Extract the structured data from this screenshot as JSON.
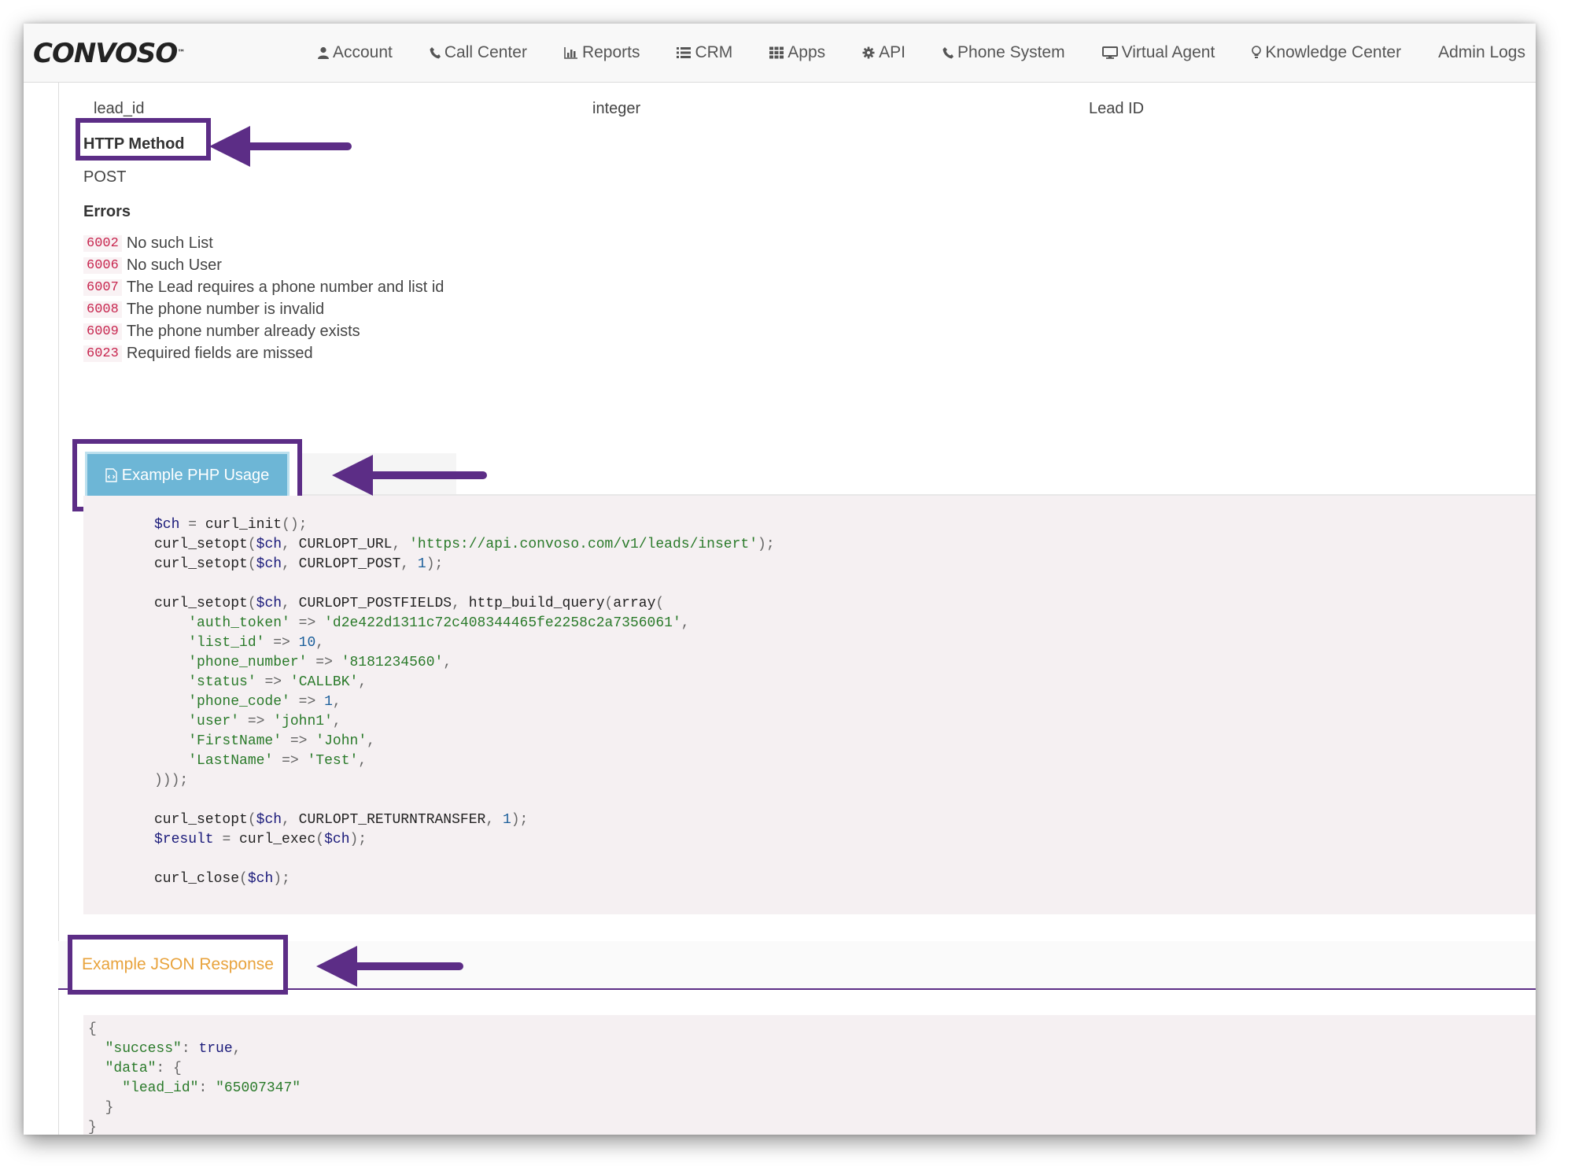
{
  "brand": {
    "logo_text": "CONVOSO"
  },
  "nav": {
    "items": [
      {
        "label": "Account",
        "icon": "user-icon"
      },
      {
        "label": "Call Center",
        "icon": "phone-icon"
      },
      {
        "label": "Reports",
        "icon": "bar-chart-icon"
      },
      {
        "label": "CRM",
        "icon": "list-icon"
      },
      {
        "label": "Apps",
        "icon": "grid-icon"
      },
      {
        "label": "API",
        "icon": "gear-icon"
      },
      {
        "label": "Phone System",
        "icon": "phone-icon"
      },
      {
        "label": "Virtual Agent",
        "icon": "monitor-icon"
      },
      {
        "label": "Knowledge Center",
        "icon": "lightbulb-icon"
      },
      {
        "label": "Admin Logs",
        "icon": ""
      }
    ]
  },
  "params_row": {
    "name": "lead_id",
    "type": "integer",
    "description": "Lead ID"
  },
  "http_method": {
    "title": "HTTP Method",
    "value": "POST"
  },
  "errors": {
    "title": "Errors",
    "items": [
      {
        "code": "6002",
        "message": "No such List"
      },
      {
        "code": "6006",
        "message": "No such User"
      },
      {
        "code": "6007",
        "message": "The Lead requires a phone number and list id"
      },
      {
        "code": "6008",
        "message": "The phone number is invalid"
      },
      {
        "code": "6009",
        "message": "The phone number already exists"
      },
      {
        "code": "6023",
        "message": "Required fields are missed"
      }
    ]
  },
  "php_example": {
    "tab_label": "Example PHP Usage",
    "url": "https://api.convoso.com/v1/leads/insert",
    "auth_token": "d2e422d1311c72c408344465fe2258c2a7356061",
    "list_id": "10",
    "phone_number": "8181234560",
    "status": "CALLBK",
    "phone_code": "1",
    "user": "john1",
    "first_name": "John",
    "last_name": "Test"
  },
  "json_example": {
    "tab_label": "Example JSON Response",
    "success": "true",
    "lead_id": "65007347"
  },
  "colors": {
    "annotation": "#5c2d86",
    "php_tab": "#6db6d6",
    "json_tab_text": "#e8a33d",
    "error_code": "#c7254e"
  }
}
